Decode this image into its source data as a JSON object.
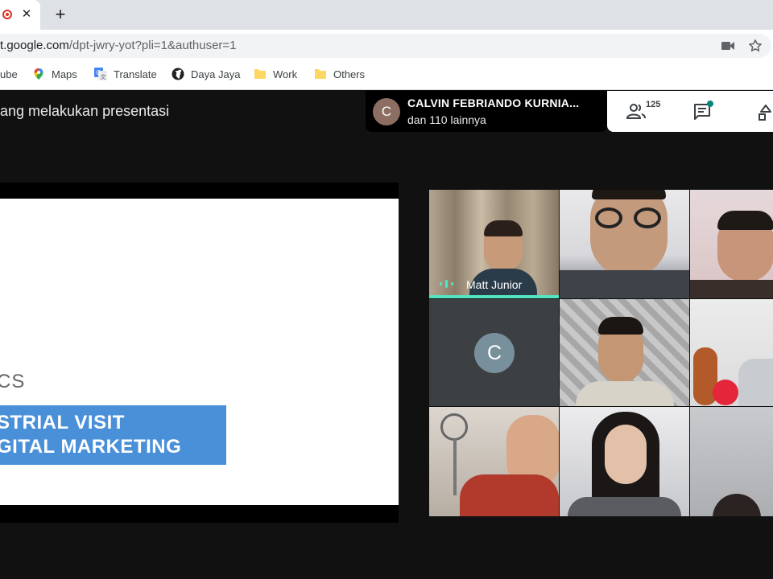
{
  "browser": {
    "url_host": "t.google.com",
    "url_path": "/dpt-jwry-yot?pli=1&authuser=1",
    "bookmarks": [
      {
        "label": "ube",
        "icon": "youtube-icon"
      },
      {
        "label": "Maps",
        "icon": "maps-pin-icon"
      },
      {
        "label": "Translate",
        "icon": "translate-icon"
      },
      {
        "label": "Daya Jaya",
        "icon": "globe-icon"
      },
      {
        "label": "Work",
        "icon": "folder-icon"
      },
      {
        "label": "Others",
        "icon": "folder-icon"
      }
    ]
  },
  "meet": {
    "presenting_label": "ang melakukan presentasi",
    "presenter_card": {
      "avatar": "C",
      "name": "CALVIN FEBRIANDO KURNIA...",
      "subtitle": "dan 110 lainnya"
    },
    "people_count": "125",
    "slide": {
      "small_text": "CS",
      "banner_line1": "STRIAL VISIT",
      "banner_line2": "GITAL MARKETING"
    },
    "tiles": [
      {
        "name": "Matt Junior",
        "speaking": true
      },
      {
        "name": "",
        "avatar": "C"
      }
    ]
  },
  "colors": {
    "meet_bg": "#111111",
    "accent_teal": "#52e5c1",
    "slide_banner": "#4a90d9",
    "chat_dot": "#00897b"
  }
}
